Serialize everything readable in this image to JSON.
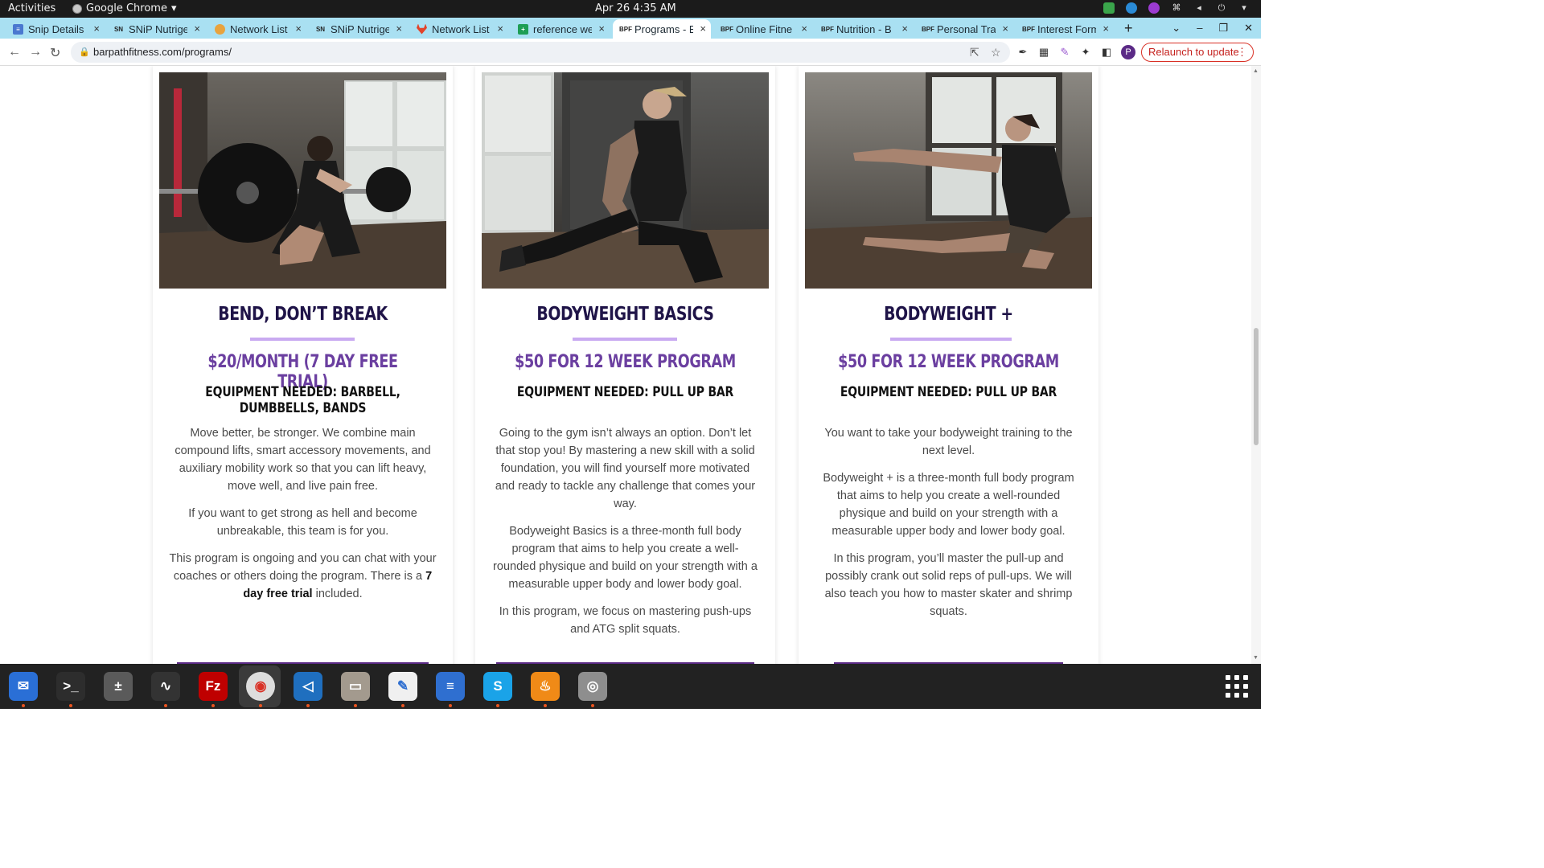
{
  "system_bar": {
    "activities": "Activities",
    "app_name": "Google Chrome",
    "clock": "Apr 26  4:35 AM"
  },
  "tabs": [
    {
      "title": "Snip Details -",
      "favicon": "doc-icon",
      "fav_color": "#4a78d0",
      "active": false
    },
    {
      "title": "SNiP Nutrige",
      "favicon": "snip-logo",
      "fav_color": "#e8e8e8",
      "active": false
    },
    {
      "title": "Network List",
      "favicon": "globe-icon",
      "fav_color": "#e8a33d",
      "active": false
    },
    {
      "title": "SNiP Nutrige",
      "favicon": "snip-logo",
      "fav_color": "#e8e8e8",
      "active": false
    },
    {
      "title": "Network List",
      "favicon": "gitlab-icon",
      "fav_color": "#e2432a",
      "active": false
    },
    {
      "title": "reference we",
      "favicon": "sheets-icon",
      "fav_color": "#1e9e55",
      "active": false
    },
    {
      "title": "Programs - B",
      "favicon": "bpf-logo",
      "fav_color": "#ffffff",
      "active": true
    },
    {
      "title": "Online Fitne",
      "favicon": "bpf-logo",
      "fav_color": "#ffffff",
      "active": false
    },
    {
      "title": "Nutrition - B",
      "favicon": "bpf-logo",
      "fav_color": "#ffffff",
      "active": false
    },
    {
      "title": "Personal Tra",
      "favicon": "bpf-logo",
      "fav_color": "#ffffff",
      "active": false
    },
    {
      "title": "Interest Form",
      "favicon": "bpf-logo",
      "fav_color": "#ffffff",
      "active": false
    }
  ],
  "toolbar": {
    "url": "barpathfitness.com/programs/",
    "relaunch_label": "Relaunch to update",
    "profile_initial": "P"
  },
  "programs": [
    {
      "title": "BEND, DON’T BREAK",
      "price": "$20/MONTH (7 DAY FREE TRIAL)",
      "equipment": "EQUIPMENT NEEDED: BARBELL, DUMBBELLS, BANDS",
      "paragraphs": [
        "Move better, be stronger. We combine main compound lifts, smart accessory movements, and auxiliary mobility work so that you can lift heavy, move well, and live pain free.",
        "If you want to get strong as hell and become unbreakable, this team is for you."
      ],
      "p3_before": "This program is ongoing and you can chat with your coaches or others doing the program. There is a ",
      "p3_bold": "7 day free trial",
      "p3_after": " included."
    },
    {
      "title": "BODYWEIGHT BASICS",
      "price": "$50 FOR 12 WEEK PROGRAM",
      "equipment": "EQUIPMENT NEEDED: PULL UP BAR",
      "paragraphs": [
        "Going to the gym isn’t always an option. Don’t let that stop you! By mastering a new skill with a solid foundation, you will find yourself more motivated and ready to tackle any challenge that comes your way.",
        "Bodyweight Basics is a three-month full body program that aims to help you create a well-rounded physique and build on your strength with a measurable upper body and lower body goal.",
        "In this program, we focus on mastering push-ups and ATG split squats."
      ]
    },
    {
      "title": "BODYWEIGHT +",
      "price": "$50 FOR 12 WEEK PROGRAM",
      "equipment": "EQUIPMENT NEEDED: PULL UP BAR",
      "paragraphs": [
        "You want to take your bodyweight training to the next level.",
        "Bodyweight + is a three-month full body program that aims to help you create a well-rounded physique and build on your strength with a measurable upper body and lower body goal.",
        "In this program, you’ll master the pull-up and possibly crank out solid reps of pull-ups. We will also teach you how to master skater and shrimp squats."
      ]
    }
  ],
  "colors": {
    "title": "#1f1448",
    "price": "#6b3fa0",
    "rule": "#c9aaf1",
    "cta": "#5b2a86",
    "tabstrip": "#a9e0f2"
  },
  "dock": [
    {
      "name": "thunderbird-icon",
      "color": "#2a6fd6",
      "glyph": "✉"
    },
    {
      "name": "terminal-icon",
      "color": "#2d2d2d",
      "glyph": ">_"
    },
    {
      "name": "calculator-icon",
      "color": "#5a5a5a",
      "glyph": "±"
    },
    {
      "name": "system-monitor-icon",
      "color": "#333333",
      "glyph": "∿"
    },
    {
      "name": "filezilla-icon",
      "color": "#bf0000",
      "glyph": "Fz"
    },
    {
      "name": "chrome-icon",
      "color": "#dddddd",
      "glyph": "◉"
    },
    {
      "name": "vscode-icon",
      "color": "#1f6fbf",
      "glyph": "◁"
    },
    {
      "name": "files-icon",
      "color": "#a39a8e",
      "glyph": "▭"
    },
    {
      "name": "text-editor-icon",
      "color": "#f0f0f0",
      "glyph": "✎"
    },
    {
      "name": "document-viewer-icon",
      "color": "#2f6fd0",
      "glyph": "≡"
    },
    {
      "name": "skype-icon",
      "color": "#1aa3e8",
      "glyph": "S"
    },
    {
      "name": "fire-app-icon",
      "color": "#f08a17",
      "glyph": "♨"
    },
    {
      "name": "disk-icon",
      "color": "#8e8e8e",
      "glyph": "◎"
    }
  ]
}
